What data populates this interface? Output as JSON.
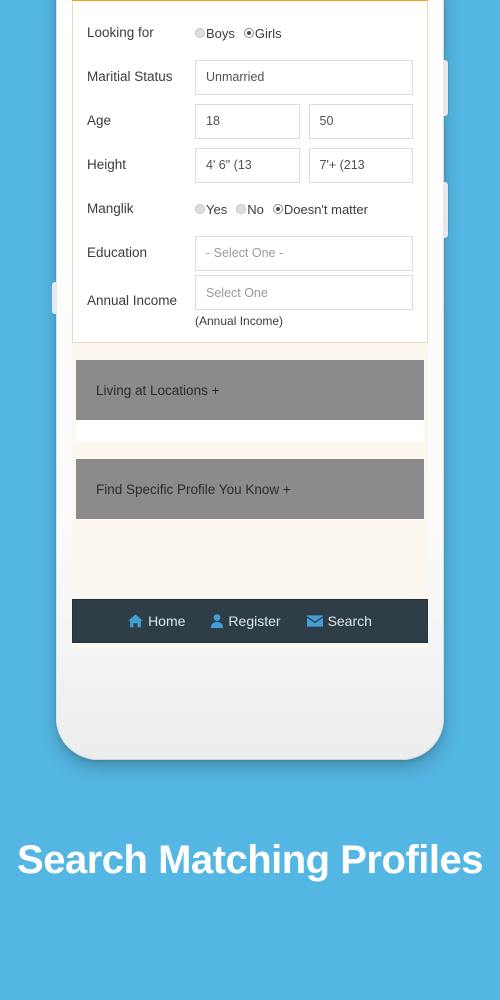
{
  "background": {
    "color": "#54b6e2"
  },
  "device": {
    "frame_color": "#f2f3f3"
  },
  "screen": {
    "header_bar_color": "#f0a01c",
    "form": {
      "rows": [
        {
          "label": "Looking for",
          "type": "radio",
          "options": [
            {
              "label": "Boys",
              "selected": false
            },
            {
              "label": "Girls",
              "selected": true
            }
          ]
        },
        {
          "label": "Maritial Status",
          "type": "select",
          "value": "Unmarried"
        },
        {
          "label": "Age",
          "type": "pair",
          "value_from": "18",
          "value_to": "50"
        },
        {
          "label": "Height",
          "type": "pair",
          "value_from": "4' 6\" (13",
          "value_to": "7'+ (213"
        },
        {
          "label": "Manglik",
          "type": "radio",
          "options": [
            {
              "label": "Yes",
              "selected": false
            },
            {
              "label": "No",
              "selected": false
            },
            {
              "label": "Doesn't matter",
              "selected": true
            }
          ]
        },
        {
          "label": "Education",
          "type": "select",
          "value": "- Select One -"
        },
        {
          "label": "Annual Income",
          "type": "select",
          "value": "Select One",
          "hint": "(Annual Income)"
        }
      ]
    },
    "panels": [
      {
        "title": "Living at Locations +"
      },
      {
        "title": "Find Specific Profile You Know +"
      }
    ],
    "navbar": {
      "background": "#2f3e46",
      "items": [
        {
          "icon": "home-icon",
          "label": "Home"
        },
        {
          "icon": "user-icon",
          "label": "Register"
        },
        {
          "icon": "envelope-icon",
          "label": "Search"
        }
      ]
    }
  },
  "caption": {
    "text": "Search Matching Profiles"
  }
}
